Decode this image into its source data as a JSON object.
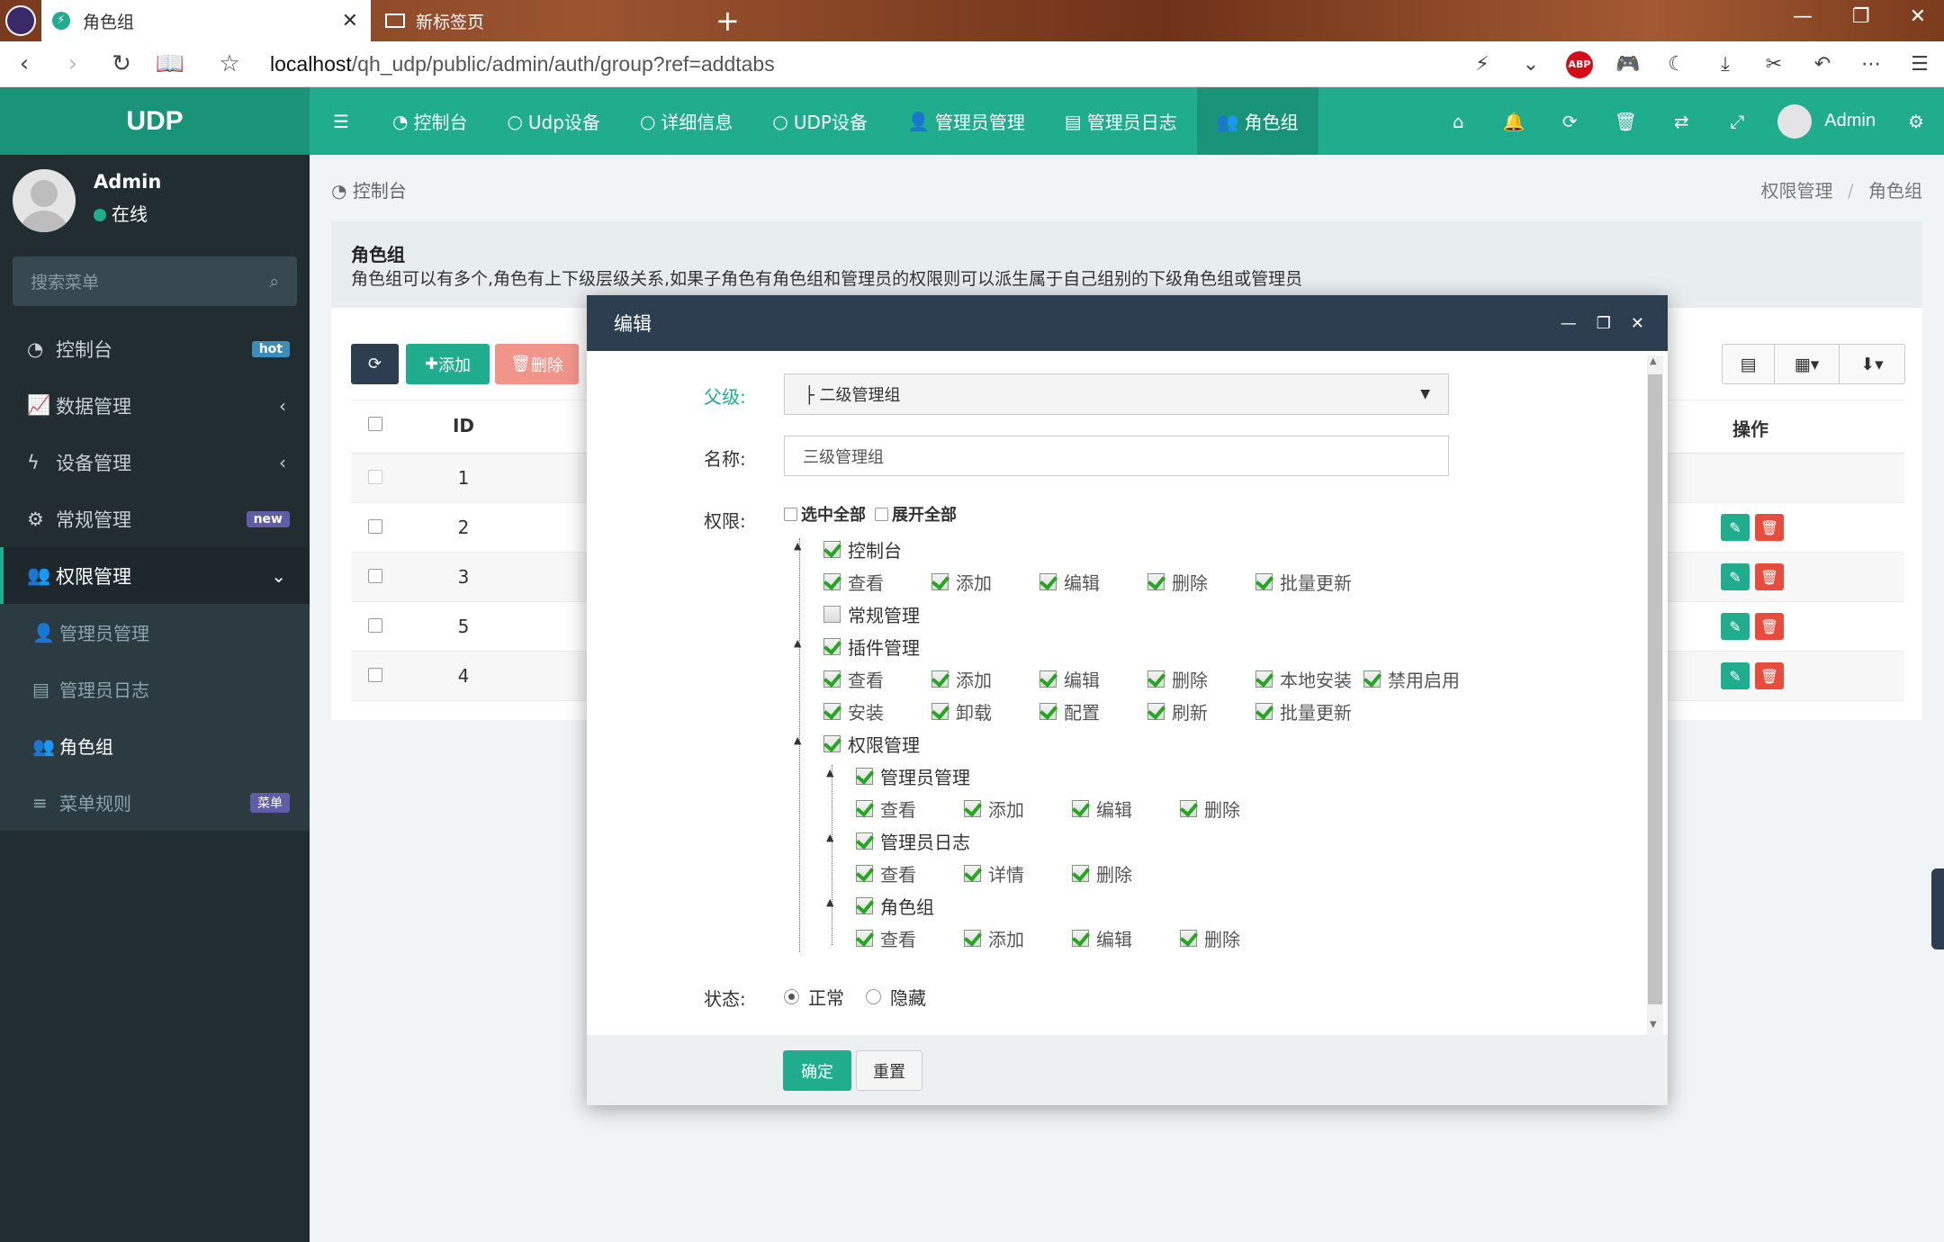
{
  "browser": {
    "tabs": [
      {
        "label": "角色组"
      },
      {
        "label": "新标签页"
      }
    ],
    "url_host": "localhost",
    "url_path": "/qh_udp/public/admin/auth/group?ref=addtabs"
  },
  "app": {
    "logo": "UDP",
    "top_menu": [
      {
        "icon": "dashboard-icon",
        "label": "控制台"
      },
      {
        "icon": "circle-icon",
        "label": "Udp设备"
      },
      {
        "icon": "circle-icon",
        "label": "详细信息"
      },
      {
        "icon": "circle-icon",
        "label": "UDP设备"
      },
      {
        "icon": "user-icon",
        "label": "管理员管理"
      },
      {
        "icon": "list-icon",
        "label": "管理员日志"
      },
      {
        "icon": "users-icon",
        "label": "角色组"
      }
    ],
    "user": "Admin"
  },
  "sidebar": {
    "user_name": "Admin",
    "status": "在线",
    "search_placeholder": "搜索菜单",
    "items": [
      {
        "label": "控制台",
        "badge": "hot"
      },
      {
        "label": "数据管理"
      },
      {
        "label": "设备管理"
      },
      {
        "label": "常规管理",
        "badge": "new"
      },
      {
        "label": "权限管理"
      }
    ],
    "subitems": [
      {
        "label": "管理员管理"
      },
      {
        "label": "管理员日志"
      },
      {
        "label": "角色组"
      },
      {
        "label": "菜单规则",
        "badge": "菜单"
      }
    ],
    "colors": {
      "hot": "#3c8dbc",
      "new": "#605ca8",
      "menu": "#605ca8"
    }
  },
  "content": {
    "breadcrumb_left": "控制台",
    "breadcrumb_right": [
      "权限管理",
      "角色组"
    ],
    "panel_title": "角色组",
    "panel_desc": "角色组可以有多个,角色有上下级层级关系,如果子角色有角色组和管理员的权限则可以派生属于自己组别的下级角色组或管理员",
    "toolbar": {
      "add": "添加",
      "delete": "删除"
    },
    "table": {
      "col_id": "ID",
      "col_op": "操作",
      "rows": [
        "1",
        "2",
        "3",
        "5",
        "4"
      ]
    }
  },
  "modal": {
    "title": "编辑",
    "parent_label": "父级:",
    "parent_value": "├ 二级管理组",
    "name_label": "名称:",
    "name_value": "三级管理组",
    "perm_label": "权限:",
    "select_all": "选中全部",
    "expand_all": "展开全部",
    "tree": {
      "n1": "控制台",
      "n1_leaves": [
        "查看",
        "添加",
        "编辑",
        "删除",
        "批量更新"
      ],
      "n2": "常规管理",
      "n3": "插件管理",
      "n3_row1": [
        "查看",
        "添加",
        "编辑",
        "删除",
        "本地安装",
        "禁用启用"
      ],
      "n3_row2": [
        "安装",
        "卸载",
        "配置",
        "刷新",
        "批量更新"
      ],
      "n4": "权限管理",
      "n4a": "管理员管理",
      "n4a_leaves": [
        "查看",
        "添加",
        "编辑",
        "删除"
      ],
      "n4b": "管理员日志",
      "n4b_leaves": [
        "查看",
        "详情",
        "删除"
      ],
      "n4c": "角色组",
      "n4c_leaves": [
        "查看",
        "添加",
        "编辑",
        "删除"
      ]
    },
    "status_label": "状态:",
    "status_normal": "正常",
    "status_hidden": "隐藏",
    "ok": "确定",
    "reset": "重置"
  }
}
